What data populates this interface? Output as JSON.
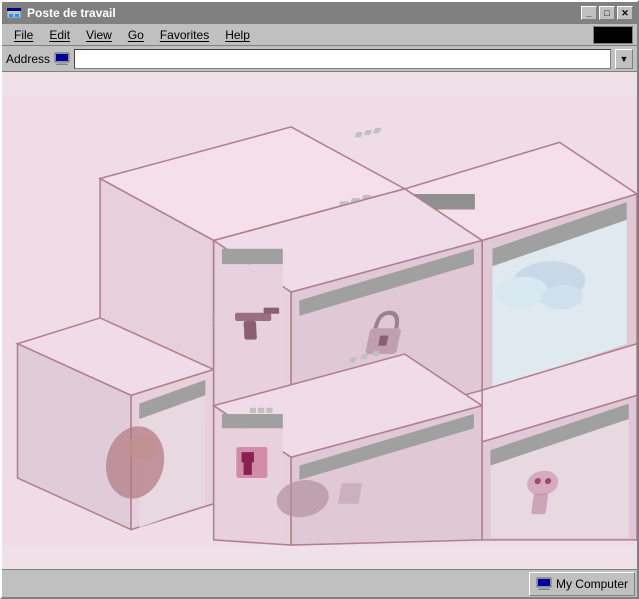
{
  "window": {
    "title": "Poste de travail",
    "icon": "computer-icon"
  },
  "titleButtons": {
    "minimize": "_",
    "maximize": "□",
    "close": "✕"
  },
  "menubar": {
    "items": [
      {
        "label": "File",
        "underline_char": "F"
      },
      {
        "label": "Edit",
        "underline_char": "E"
      },
      {
        "label": "View",
        "underline_char": "V"
      },
      {
        "label": "Go",
        "underline_char": "G"
      },
      {
        "label": "Favorites",
        "underline_char": "a"
      },
      {
        "label": "Help",
        "underline_char": "H"
      }
    ]
  },
  "addressBar": {
    "label": "Address",
    "value": "",
    "placeholder": ""
  },
  "statusBar": {
    "label": "My Computer",
    "icon": "my-computer-icon"
  },
  "colors": {
    "titleBarActive": "#808080",
    "windowBg": "#c0c0c0",
    "contentBg": "#f0e0e8",
    "accentPink": "#c87090",
    "darkPink": "#8b0050"
  }
}
